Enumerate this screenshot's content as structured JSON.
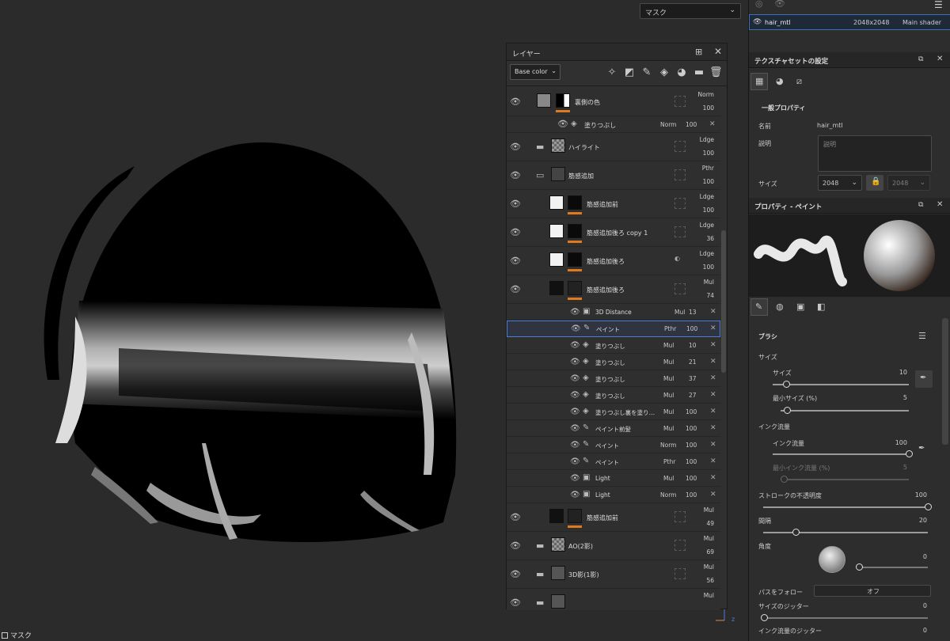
{
  "viewport": {
    "dropdown": "マスク",
    "status": "マスク",
    "axis_label": "z"
  },
  "texture_set": {
    "name": "hair_mtl",
    "size": "2048x2048",
    "shader": "Main shader"
  },
  "layers_panel": {
    "title": "レイヤー",
    "channel": "Base color",
    "rows": [
      {
        "name": "裏側の色",
        "blend": "Norm",
        "opacity": "100"
      },
      {
        "name": "ハイライト",
        "blend": "Ldge",
        "opacity": "100"
      },
      {
        "name": "筋感追加",
        "blend": "Pthr",
        "opacity": "100"
      },
      {
        "name": "筋感追加前",
        "blend": "Ldge",
        "opacity": "100"
      },
      {
        "name": "筋感追加後ろ copy 1",
        "blend": "Ldge",
        "opacity": "36"
      },
      {
        "name": "筋感追加後ろ",
        "blend": "Ldge",
        "opacity": "100"
      },
      {
        "name": "筋感追加後ろ",
        "blend": "Mul",
        "opacity": "74"
      },
      {
        "name": "筋感追加前",
        "blend": "Mul",
        "opacity": "49"
      },
      {
        "name": "AO(2影)",
        "blend": "Mul",
        "opacity": "69"
      },
      {
        "name": "3D影(1影)",
        "blend": "Mul",
        "opacity": "56"
      },
      {
        "name": "",
        "blend": "Mul",
        "opacity": ""
      }
    ],
    "fill_sub": {
      "name": "塗りつぶし",
      "blend": "Norm",
      "opacity": "100"
    },
    "effects": [
      {
        "name": "3D Distance",
        "blend": "Mul",
        "opacity": "13"
      },
      {
        "name": "ペイント",
        "blend": "Pthr",
        "opacity": "100"
      },
      {
        "name": "塗りつぶし",
        "blend": "Mul",
        "opacity": "10"
      },
      {
        "name": "塗りつぶし",
        "blend": "Mul",
        "opacity": "21"
      },
      {
        "name": "塗りつぶし",
        "blend": "Mul",
        "opacity": "37"
      },
      {
        "name": "塗りつぶし",
        "blend": "Mul",
        "opacity": "27"
      },
      {
        "name": "塗りつぶし裏を塗り…",
        "blend": "Mul",
        "opacity": "100"
      },
      {
        "name": "ペイント前髪",
        "blend": "Mul",
        "opacity": "100"
      },
      {
        "name": "ペイント",
        "blend": "Norm",
        "opacity": "100"
      },
      {
        "name": "ペイント",
        "blend": "Pthr",
        "opacity": "100"
      },
      {
        "name": "Light",
        "blend": "Mul",
        "opacity": "100"
      },
      {
        "name": "Light",
        "blend": "Norm",
        "opacity": "100"
      }
    ]
  },
  "textureset_settings": {
    "title": "テクスチャセットの設定",
    "section": "一般プロパティ",
    "name_label": "名前",
    "name_value": "hair_mtl",
    "desc_label": "説明",
    "desc_placeholder": "説明",
    "size_label": "サイズ",
    "size_value": "2048",
    "size_value2": "2048"
  },
  "paint_props": {
    "title": "プロパティ - ペイント",
    "brush_section": "ブラシ",
    "size_group": "サイズ",
    "size_label": "サイズ",
    "size_value": "10",
    "min_size_label": "最小サイズ (%)",
    "min_size_value": "5",
    "flow_group": "インク流量",
    "flow_label": "インク流量",
    "flow_value": "100",
    "min_flow_label": "最小インク流量 (%)",
    "min_flow_value": "5",
    "stroke_opacity_label": "ストロークの不透明度",
    "stroke_opacity_value": "100",
    "spacing_label": "間隔",
    "spacing_value": "20",
    "angle_label": "角度",
    "angle_value": "0",
    "follow_path_label": "パスをフォロー",
    "follow_path_value": "オフ",
    "size_jitter_label": "サイズのジッター",
    "size_jitter_value": "0",
    "flow_jitter_label": "インク流量のジッター",
    "flow_jitter_value": "0",
    "size_pct": 0.1,
    "min_size_pct": 0.05,
    "flow_pct": 1.0,
    "stroke_pct": 1.0,
    "spacing_pct": 0.2
  }
}
